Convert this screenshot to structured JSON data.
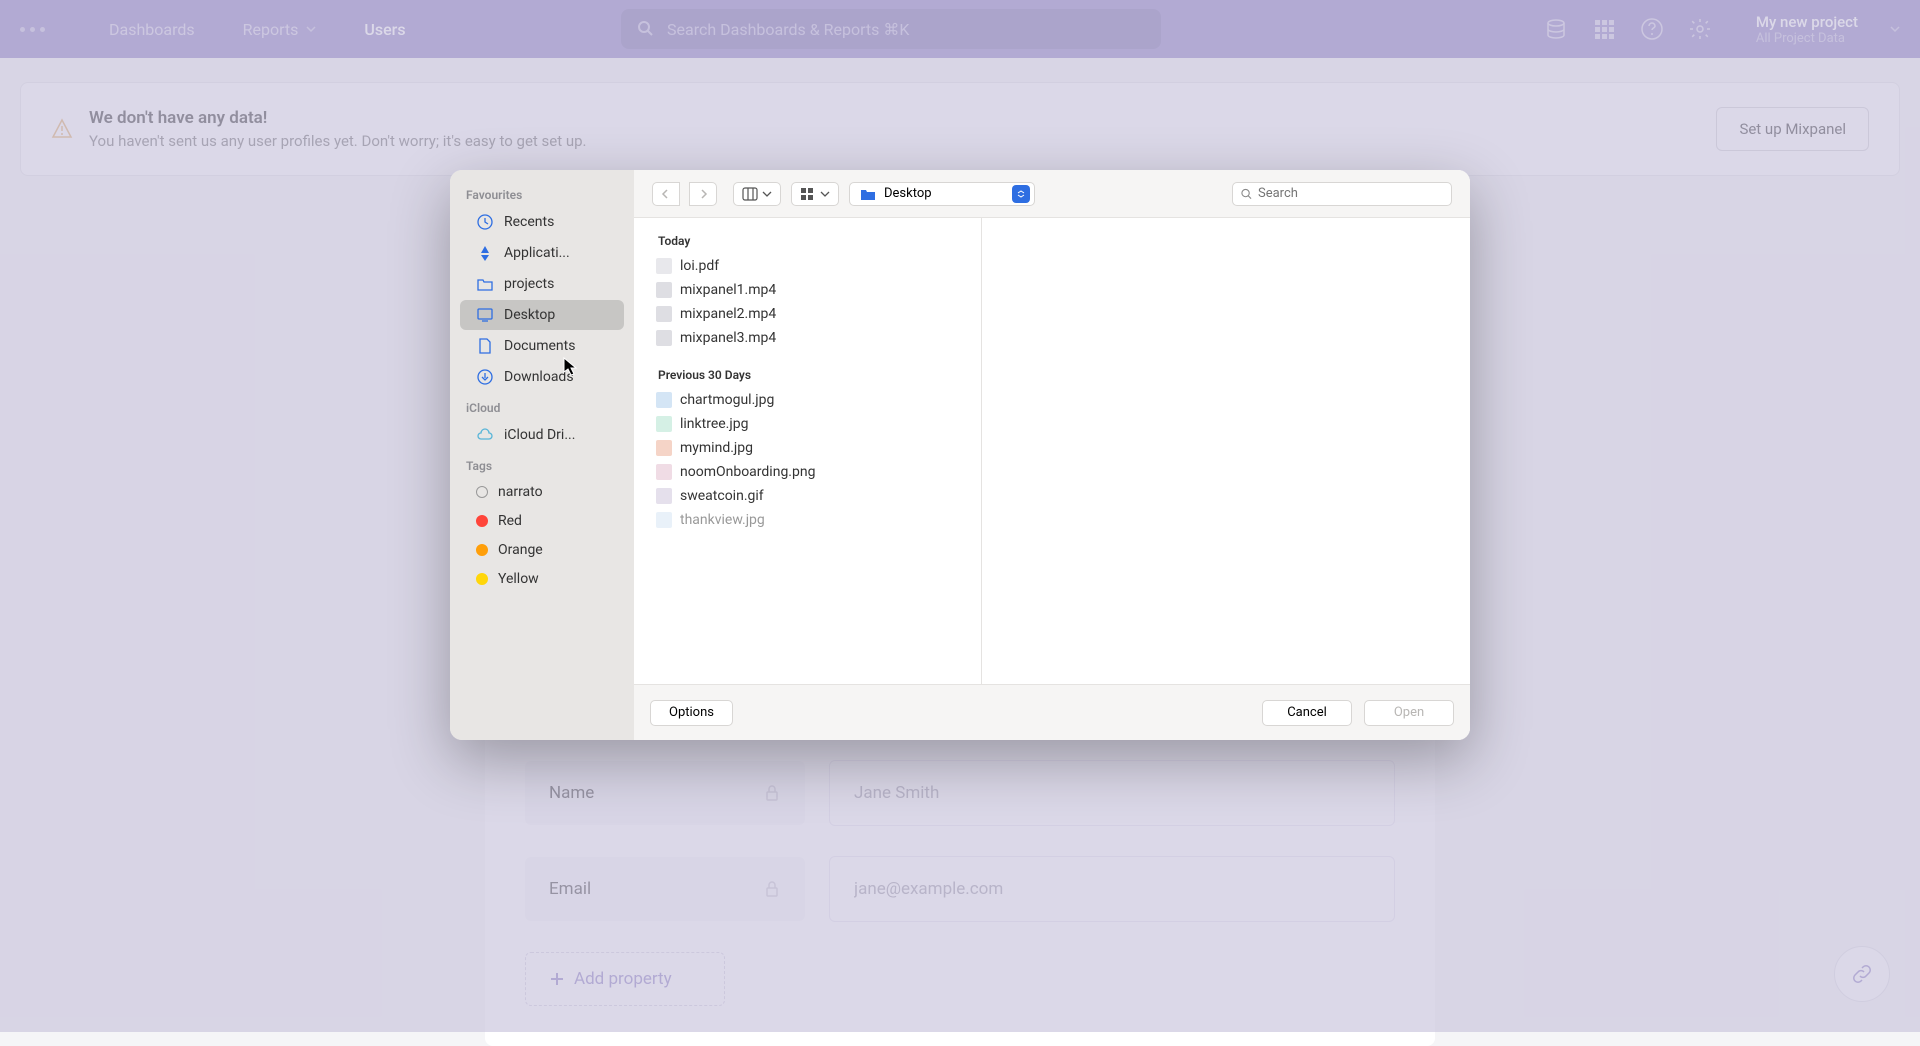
{
  "header": {
    "nav": {
      "dashboards": "Dashboards",
      "reports": "Reports",
      "users": "Users"
    },
    "search_placeholder": "Search Dashboards & Reports ⌘K",
    "project_title": "My new project",
    "project_sub": "All Project Data"
  },
  "banner": {
    "title": "We don't have any data!",
    "subtitle": "You haven't sent us any user profiles yet. Don't worry; it's easy to get set up.",
    "button": "Set up Mixpanel"
  },
  "form": {
    "name_label": "Name",
    "name_placeholder": "Jane Smith",
    "email_label": "Email",
    "email_placeholder": "jane@example.com",
    "add_property": "Add property"
  },
  "dialog": {
    "sidebar": {
      "favourites_label": "Favourites",
      "favourites": {
        "recents": "Recents",
        "applications": "Applicati...",
        "projects": "projects",
        "desktop": "Desktop",
        "documents": "Documents",
        "downloads": "Downloads"
      },
      "icloud_label": "iCloud",
      "icloud_drive": "iCloud Dri...",
      "tags_label": "Tags",
      "tags": {
        "narrato": "narrato",
        "red": "Red",
        "orange": "Orange",
        "yellow": "Yellow"
      }
    },
    "location": "Desktop",
    "search_placeholder": "Search",
    "sections": {
      "today": "Today",
      "previous": "Previous 30 Days"
    },
    "files_today": {
      "f0": "loi.pdf",
      "f1": "mixpanel1.mp4",
      "f2": "mixpanel2.mp4",
      "f3": "mixpanel3.mp4"
    },
    "files_prev": {
      "f0": "chartmogul.jpg",
      "f1": "linktree.jpg",
      "f2": "mymind.jpg",
      "f3": "noomOnboarding.png",
      "f4": "sweatcoin.gif",
      "f5": "thankview.jpg"
    },
    "buttons": {
      "options": "Options",
      "cancel": "Cancel",
      "open": "Open"
    }
  }
}
